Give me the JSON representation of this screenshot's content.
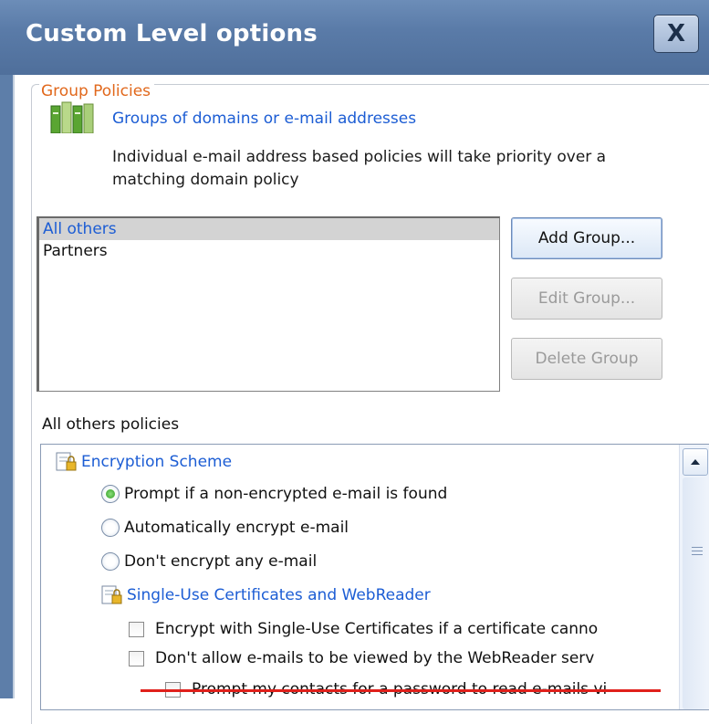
{
  "window": {
    "title": "Custom Level options",
    "close_label": "X"
  },
  "group_policies": {
    "legend": "Group Policies",
    "heading": "Groups of domains or e-mail addresses",
    "description": "Individual e-mail address based policies will take priority over a matching domain policy"
  },
  "groups": {
    "items": [
      {
        "label": "All others",
        "selected": true
      },
      {
        "label": "Partners",
        "selected": false
      }
    ]
  },
  "buttons": {
    "add": "Add Group...",
    "edit": "Edit Group...",
    "delete": "Delete Group"
  },
  "policies": {
    "label": "All others policies",
    "encryption_scheme": "Encryption Scheme",
    "options": [
      {
        "label": "Prompt if a non-encrypted e-mail is found",
        "checked": true
      },
      {
        "label": "Automatically encrypt e-mail",
        "checked": false
      },
      {
        "label": "Don't encrypt any e-mail",
        "checked": false
      }
    ],
    "certificates_heading": "Single-Use Certificates and WebReader",
    "checks": [
      {
        "label": "Encrypt with Single-Use Certificates if a certificate canno",
        "checked": false
      },
      {
        "label": "Don't allow e-mails to be viewed by the WebReader serv",
        "checked": false
      },
      {
        "label": "Prompt my contacts for a password to read e-mails vi",
        "checked": false
      }
    ]
  },
  "colors": {
    "titlebar": "#5a7ba8",
    "legend": "#e1681c",
    "link_blue": "#1c5dd4",
    "highlight_line": "#e0201b"
  },
  "icons": {
    "group": "books-icon",
    "policy": "document-lock-icon",
    "scroll_up": "chevron-up-icon"
  }
}
